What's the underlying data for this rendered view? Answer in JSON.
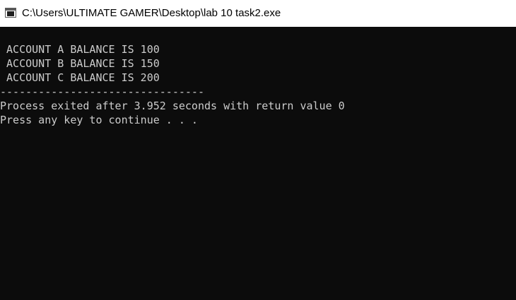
{
  "window": {
    "title": "C:\\Users\\ULTIMATE GAMER\\Desktop\\lab 10 task2.exe",
    "icon": "console-app-icon"
  },
  "console": {
    "lines": [
      " ACCOUNT A BALANCE IS 100",
      " ACCOUNT B BALANCE IS 150",
      " ACCOUNT C BALANCE IS 200",
      "--------------------------------",
      "Process exited after 3.952 seconds with return value 0",
      "Press any key to continue . . ."
    ],
    "colors": {
      "background": "#0c0c0c",
      "text": "#cccccc"
    }
  }
}
